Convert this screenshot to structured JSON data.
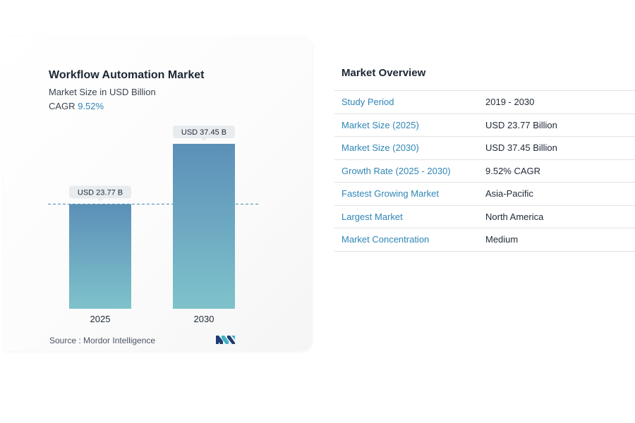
{
  "chart_data": {
    "type": "bar",
    "title": "Workflow Automation Market",
    "subtitle": "Market Size in USD Billion",
    "cagr_label": "CAGR",
    "cagr_value": "9.52%",
    "categories": [
      "2025",
      "2030"
    ],
    "values": [
      23.77,
      37.45
    ],
    "data_labels": [
      "USD 23.77 B",
      "USD 37.45 B"
    ],
    "ylim": [
      0,
      37.45
    ],
    "reference_line_value": 23.77,
    "grid": false,
    "colors": {
      "bar_top": "#5b90b8",
      "bar_bottom": "#7fc2cb",
      "reference_line": "#4a88b0",
      "label_bg": "#e9ecef"
    }
  },
  "source": {
    "label": "Source :",
    "name": "Mordor Intelligence"
  },
  "logo": {
    "icon": "mordor-intelligence-logo-icon",
    "colors": [
      "#1f3d73",
      "#3fb3c3"
    ]
  },
  "overview": {
    "title": "Market Overview",
    "rows": [
      {
        "key": "Study Period",
        "value": "2019 - 2030"
      },
      {
        "key": "Market Size (2025)",
        "value": "USD 23.77 Billion"
      },
      {
        "key": "Market Size (2030)",
        "value": "USD 37.45 Billion"
      },
      {
        "key": "Growth Rate (2025 - 2030)",
        "value": "9.52% CAGR"
      },
      {
        "key": "Fastest Growing Market",
        "value": "Asia-Pacific"
      },
      {
        "key": "Largest Market",
        "value": "North America"
      },
      {
        "key": "Market Concentration",
        "value": "Medium"
      }
    ]
  }
}
